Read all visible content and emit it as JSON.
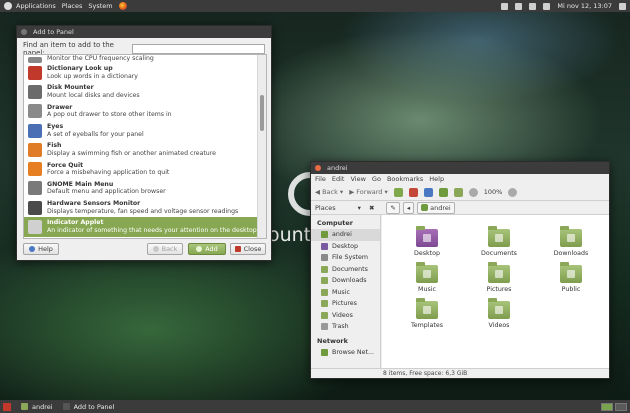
{
  "top_panel": {
    "menus": [
      "Applications",
      "Places",
      "System"
    ],
    "datetime": "Mi nov 12, 13:07"
  },
  "wallpaper": {
    "text": "ount"
  },
  "add_panel": {
    "title": "Add to Panel",
    "find_label": "Find an item to add to the panel:",
    "find_value": "",
    "items": [
      {
        "name": "",
        "desc": "Monitor the CPU frequency scaling",
        "icon_color": "#888888"
      },
      {
        "name": "Dictionary Look up",
        "desc": "Look up words in a dictionary",
        "icon_color": "#c0392b"
      },
      {
        "name": "Disk Mounter",
        "desc": "Mount local disks and devices",
        "icon_color": "#6b6b6b"
      },
      {
        "name": "Drawer",
        "desc": "A pop out drawer to store other items in",
        "icon_color": "#8a8a8a"
      },
      {
        "name": "Eyes",
        "desc": "A set of eyeballs for your panel",
        "icon_color": "#4a6fb5"
      },
      {
        "name": "Fish",
        "desc": "Display a swimming fish or another animated creature",
        "icon_color": "#e07b28"
      },
      {
        "name": "Force Quit",
        "desc": "Force a misbehaving application to quit",
        "icon_color": "#e67e22"
      },
      {
        "name": "GNOME Main Menu",
        "desc": "Default menu and application browser",
        "icon_color": "#7a7a7a"
      },
      {
        "name": "Hardware Sensors Monitor",
        "desc": "Displays temperature, fan speed and voltage sensor readings",
        "icon_color": "#4a4a4a"
      },
      {
        "name": "Indicator Applet",
        "desc": "An indicator of something that needs your attention on the desktop",
        "icon_color": "#d0d0d0"
      }
    ],
    "selected_index": 9,
    "help_label": "Help",
    "back_label": "Back",
    "add_label": "Add",
    "close_label": "Close"
  },
  "file_manager": {
    "title": "andrei",
    "menu": [
      "File",
      "Edit",
      "View",
      "Go",
      "Bookmarks",
      "Help"
    ],
    "back_label": "Back",
    "forward_label": "Forward",
    "zoom": "100%",
    "places_label": "Places",
    "path": "andrei",
    "sidebar": {
      "computer_header": "Computer",
      "computer_items": [
        "andrei",
        "Desktop",
        "File System",
        "Documents",
        "Downloads",
        "Music",
        "Pictures",
        "Videos",
        "Trash"
      ],
      "network_header": "Network",
      "network_items": [
        "Browse Net..."
      ]
    },
    "files": [
      "Desktop",
      "Documents",
      "Downloads",
      "Music",
      "Pictures",
      "Public",
      "Templates",
      "Videos"
    ],
    "status": "8 items, Free space: 6,3 GiB"
  },
  "bottom_panel": {
    "tasks": [
      "andrei",
      "Add to Panel"
    ]
  }
}
